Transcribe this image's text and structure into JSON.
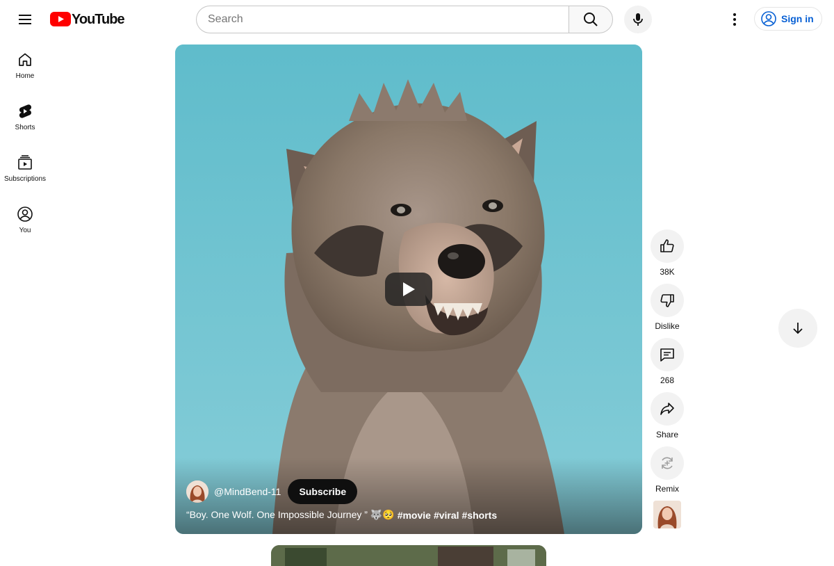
{
  "header": {
    "logo_text": "YouTube",
    "search_placeholder": "Search",
    "signin_label": "Sign in"
  },
  "sidebar": {
    "items": [
      {
        "label": "Home",
        "icon": "home-icon"
      },
      {
        "label": "Shorts",
        "icon": "shorts-icon"
      },
      {
        "label": "Subscriptions",
        "icon": "subscriptions-icon"
      },
      {
        "label": "You",
        "icon": "you-icon"
      }
    ]
  },
  "short": {
    "channel_name": "@MindBend-11",
    "subscribe_label": "Subscribe",
    "title": "“Boy. One Wolf. One Impossible Journey ” 🐺🥺",
    "hashtags": [
      "#movie",
      "#viral",
      "#shorts"
    ]
  },
  "actions": {
    "like_count": "38K",
    "dislike_label": "Dislike",
    "comment_count": "268",
    "share_label": "Share",
    "remix_label": "Remix"
  },
  "colors": {
    "brand_red": "#ff0000",
    "link_blue": "#065fd4",
    "sky": "#6dc1cf"
  }
}
